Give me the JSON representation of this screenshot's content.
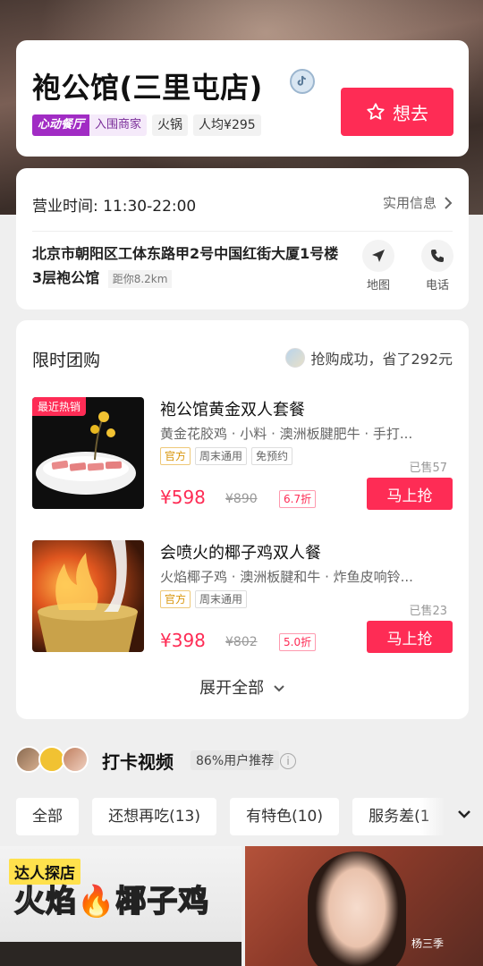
{
  "shop": {
    "name": "袍公馆(三里屯店)",
    "list_badge_a": "心动餐厅",
    "list_badge_b": "入围商家",
    "tags": [
      "火锅",
      "人均¥295"
    ],
    "want_label": "想去"
  },
  "info": {
    "hours": "营业时间: 11:30-22:00",
    "practical_label": "实用信息",
    "address": "北京市朝阳区工体东路甲2号中国红街大厦1号楼3层袍公馆",
    "distance": "距你8.2km",
    "map_label": "地图",
    "phone_label": "电话"
  },
  "deals": {
    "title": "限时团购",
    "success_text": "抢购成功，省了292元",
    "items": [
      {
        "badge": "最近热销",
        "name": "袍公馆黄金双人套餐",
        "desc": "黄金花胶鸡 · 小料 · 澳洲板腱肥牛 · 手打...",
        "chips": [
          "官方",
          "周末通用",
          "免预约"
        ],
        "sold": "已售57",
        "price": "¥598",
        "original": "¥890",
        "discount": "6.7折",
        "button": "马上抢"
      },
      {
        "badge": "",
        "name": "会喷火的椰子鸡双人餐",
        "desc": "火焰椰子鸡 · 澳洲板腱和牛 · 炸鱼皮响铃...",
        "chips": [
          "官方",
          "周末通用"
        ],
        "sold": "已售23",
        "price": "¥398",
        "original": "¥802",
        "discount": "5.0折",
        "button": "马上抢"
      }
    ],
    "expand_label": "展开全部"
  },
  "checkin": {
    "title": "打卡视频",
    "recommend": "86%用户推荐",
    "filters": [
      "全部",
      "还想再吃(13)",
      "有特色(10)",
      "服务差(1"
    ]
  },
  "videos": {
    "badge": "达人探店",
    "caption": "火焰🔥椰子鸡",
    "watermark": "杨三季"
  }
}
